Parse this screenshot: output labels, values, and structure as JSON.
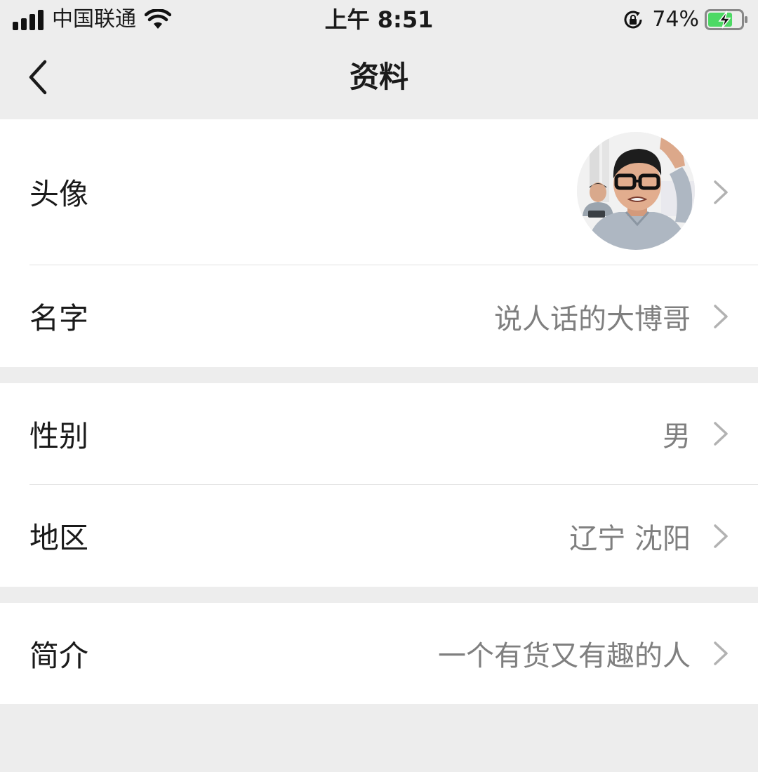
{
  "status_bar": {
    "carrier": "中国联通",
    "time": "上午 8:51",
    "battery_percent": "74%",
    "battery_level": 0.74,
    "icons": [
      "signal-icon",
      "wifi-icon",
      "rotation-lock-icon",
      "battery-charging-icon"
    ]
  },
  "nav": {
    "title": "资料",
    "back_icon": "chevron-left-icon"
  },
  "profile": {
    "avatar": {
      "label": "头像"
    },
    "name": {
      "label": "名字",
      "value": "说人话的大博哥"
    },
    "gender": {
      "label": "性别",
      "value": "男"
    },
    "region": {
      "label": "地区",
      "value": "辽宁 沈阳"
    },
    "bio": {
      "label": "简介",
      "value": "一个有货又有趣的人"
    }
  },
  "colors": {
    "background": "#ededed",
    "card": "#ffffff",
    "secondary_text": "#7f7f7f",
    "chevron": "#b2b2b2",
    "battery_green": "#4cd964"
  }
}
